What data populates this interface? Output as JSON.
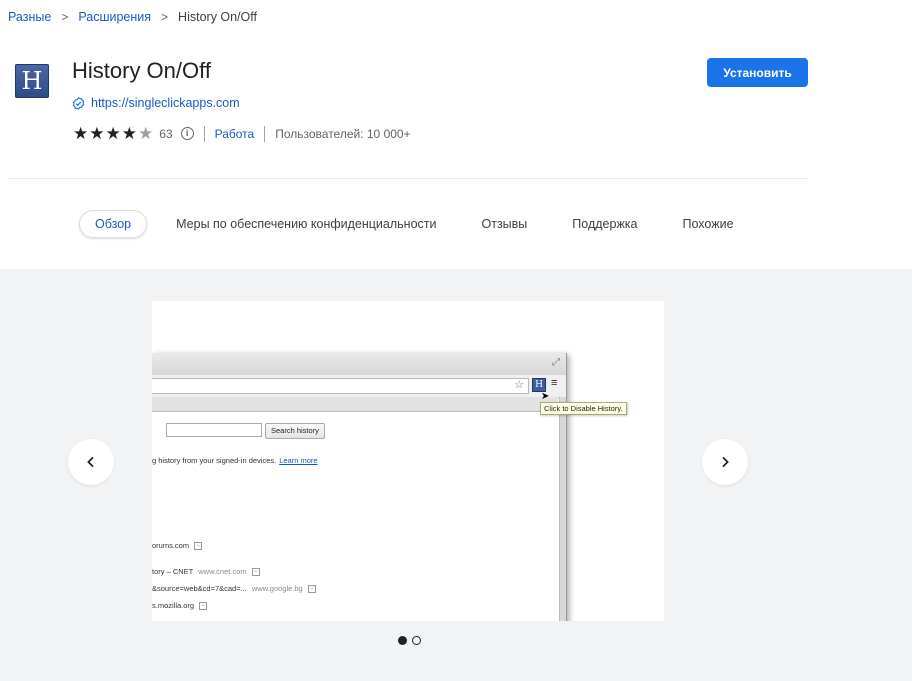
{
  "breadcrumb": {
    "items": [
      "Разные",
      "Расширения"
    ],
    "current": "History On/Off"
  },
  "app": {
    "icon_letter": "H",
    "title": "History On/Off",
    "website": "https://singleclickapps.com",
    "rating": 4,
    "rating_max": 5,
    "rating_count": "63",
    "category": "Работа",
    "users": "Пользователей: 10 000+",
    "install_label": "Установить"
  },
  "tabs": [
    "Обзор",
    "Меры по обеспечению конфиденциальности",
    "Отзывы",
    "Поддержка",
    "Похожие"
  ],
  "active_tab": 0,
  "gallery": {
    "total_slides": 2,
    "active_slide": 0,
    "screenshot": {
      "ext_icon_letter": "H",
      "tooltip": "Click to Disable History.",
      "search_button": "Search history",
      "sync_text": "g history from your signed-in devices.",
      "learn_more": "Learn more",
      "history_rows": [
        {
          "title": "orums.com",
          "domain": ""
        },
        {
          "title": "tory – CNET",
          "domain": "www.cnet.com"
        },
        {
          "title": "&source=web&cd=7&cad=...",
          "domain": "www.google.bg"
        },
        {
          "title": "s.mozilla.org",
          "domain": ""
        }
      ]
    }
  },
  "colors": {
    "accent": "#1a73e8",
    "link": "#1a59c5",
    "gallery_bg": "#f1f3f4"
  }
}
